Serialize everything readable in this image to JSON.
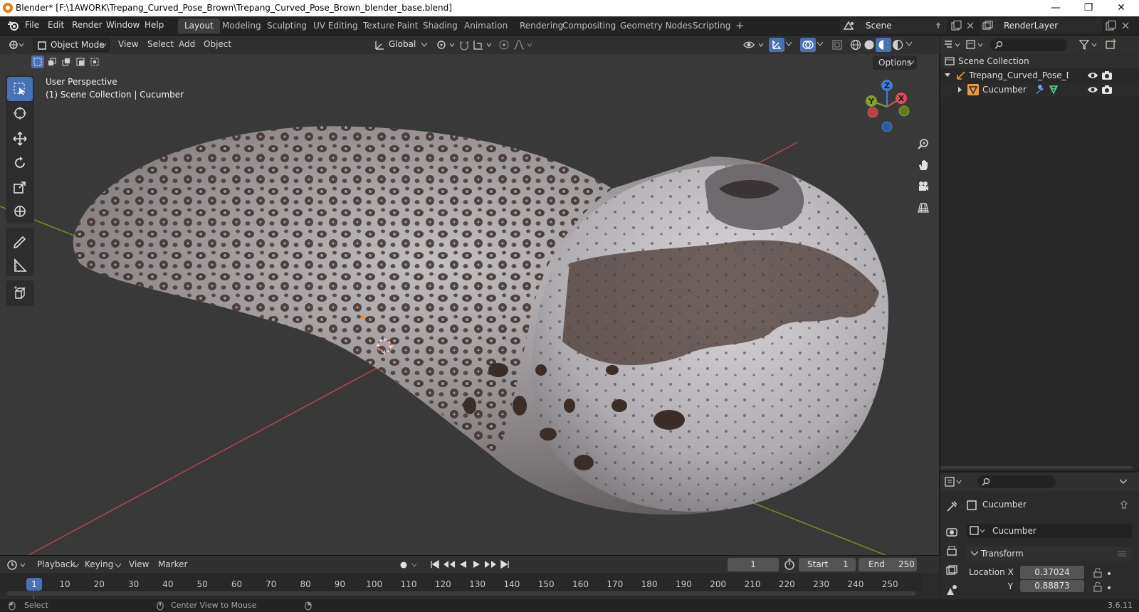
{
  "window": {
    "title": "Blender* [F:\\1AWORK\\Trepang_Curved_Pose_Brown\\Trepang_Curved_Pose_Brown_blender_base.blend]",
    "min_label": "—",
    "max_label": "❐",
    "close_label": "✕"
  },
  "menu": {
    "items": [
      "File",
      "Edit",
      "Render",
      "Window",
      "Help"
    ]
  },
  "workspaces": {
    "tabs": [
      "Layout",
      "Modeling",
      "Sculpting",
      "UV Editing",
      "Texture Paint",
      "Shading",
      "Animation",
      "Rendering",
      "Compositing",
      "Geometry Nodes",
      "Scripting"
    ],
    "active": "Layout",
    "add_label": "+"
  },
  "scene": {
    "name": "Scene"
  },
  "view_layer": {
    "name": "RenderLayer"
  },
  "viewport_header": {
    "mode": "Object Mode",
    "menus": [
      "View",
      "Select",
      "Add",
      "Object"
    ],
    "orientation": "Global",
    "options_label": "Options"
  },
  "viewport_overlay": {
    "perspective": "User Perspective",
    "context": "(1) Scene Collection | Cucumber"
  },
  "gizmo": {
    "x": "X",
    "y": "Y",
    "z": "Z"
  },
  "outliner": {
    "root": "Scene Collection",
    "items": [
      {
        "label": "Trepang_Curved_Pose_Browi",
        "type": "empty"
      },
      {
        "label": "Cucumber",
        "type": "mesh"
      }
    ]
  },
  "properties": {
    "object_name": "Cucumber",
    "datablock": "Cucumber",
    "panel": "Transform",
    "location_x_label": "Location X",
    "location_x": "0.37024",
    "location_y_label": "Y",
    "location_y": "0.88873"
  },
  "timeline": {
    "menus": [
      "Playback",
      "Keying",
      "View",
      "Marker"
    ],
    "current_frame": "1",
    "start_label": "Start",
    "start": "1",
    "end_label": "End",
    "end": "250",
    "ruler": [
      "1",
      "10",
      "20",
      "30",
      "40",
      "50",
      "60",
      "70",
      "80",
      "90",
      "100",
      "110",
      "120",
      "130",
      "140",
      "150",
      "160",
      "170",
      "180",
      "190",
      "200",
      "210",
      "220",
      "230",
      "240",
      "250"
    ]
  },
  "statusbar": {
    "left": "Select",
    "middle": "Center View to Mouse",
    "version": "3.6.11"
  },
  "colors": {
    "accent": "#4772b3",
    "x_axis": "#d7505a",
    "y_axis": "#7fa32a",
    "z_axis": "#3f7dd6"
  }
}
